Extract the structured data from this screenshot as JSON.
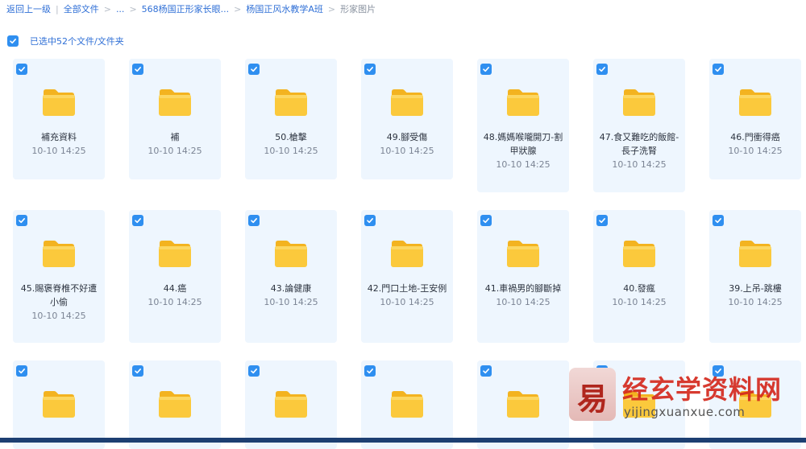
{
  "breadcrumb": {
    "back": "返回上一级",
    "items": [
      "全部文件",
      "...",
      "568杨国正形家长眼...",
      "杨国正风水教学A班"
    ],
    "current": "形家图片"
  },
  "selection": {
    "label": "已选中52个文件/文件夹"
  },
  "folder_icon": "folder-icon",
  "colors": {
    "accent": "#2f8ff0",
    "card_bg": "#eef6fe",
    "folder": "#f9c53a"
  },
  "folders": [
    {
      "name": "補充資料",
      "time": "10-10 14:25"
    },
    {
      "name": "補",
      "time": "10-10 14:25"
    },
    {
      "name": "50.槍擊",
      "time": "10-10 14:25"
    },
    {
      "name": "49.腳受傷",
      "time": "10-10 14:25"
    },
    {
      "name": "48.媽媽喉嚨開刀-割甲狀腺",
      "time": "10-10 14:25"
    },
    {
      "name": "47.食又難吃的飯館-長子洗腎",
      "time": "10-10 14:25"
    },
    {
      "name": "46.門衝得癌",
      "time": "10-10 14:25"
    },
    {
      "name": "45.賜褒脊椎不好遭小偷",
      "time": "10-10 14:25"
    },
    {
      "name": "44.癌",
      "time": "10-10 14:25"
    },
    {
      "name": "43.論健康",
      "time": "10-10 14:25"
    },
    {
      "name": "42.門口土地-王安例",
      "time": "10-10 14:25"
    },
    {
      "name": "41.車禍男的腳斷掉",
      "time": "10-10 14:25"
    },
    {
      "name": "40.發瘋",
      "time": "10-10 14:25"
    },
    {
      "name": "39.上吊-跳樓",
      "time": "10-10 14:25"
    },
    {
      "name": "",
      "time": ""
    },
    {
      "name": "",
      "time": ""
    },
    {
      "name": "",
      "time": ""
    },
    {
      "name": "",
      "time": ""
    },
    {
      "name": "",
      "time": ""
    },
    {
      "name": "",
      "time": ""
    },
    {
      "name": "",
      "time": ""
    }
  ],
  "watermark": {
    "logo_char": "易",
    "title": "经玄学资料网",
    "url": "yijingxuanxue.com"
  }
}
